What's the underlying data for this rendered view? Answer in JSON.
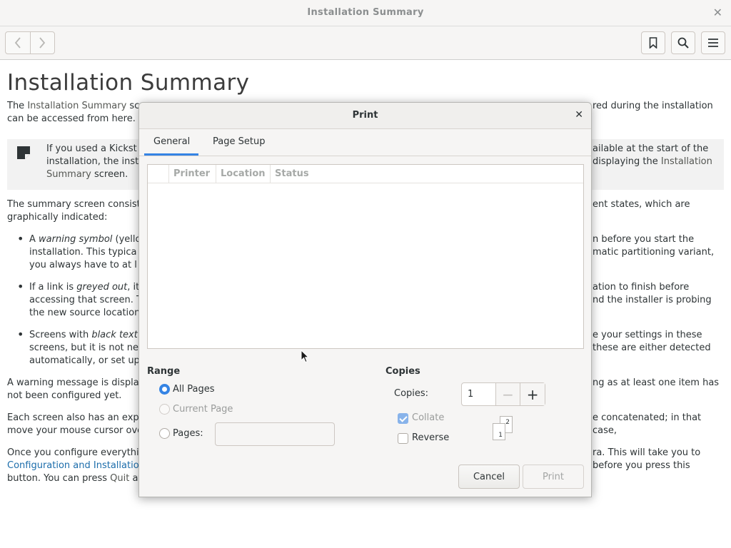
{
  "window": {
    "title": "Installation Summary"
  },
  "toolbar": {
    "back_icon": "chevron-left-icon",
    "forward_icon": "chevron-right-icon",
    "bookmark_icon": "bookmark-icon",
    "search_icon": "search-icon",
    "menu_icon": "hamburger-menu-icon"
  },
  "document": {
    "heading": "Installation Summary",
    "intro": {
      "left_1a": "The ",
      "left_1b": "Installation Summary",
      "left_1c": " sc",
      "left_2": "can be accessed from here.",
      "right_1": "red during the installation"
    },
    "note": {
      "left_1": "If you used a Kickst",
      "left_2": "installation, the inst",
      "left_3a": "Summary",
      "left_3b": " screen.",
      "right_1": "ailable at the start of the",
      "right_2a": " displaying the ",
      "right_2b": "Installation"
    },
    "para2": {
      "left_1": "The summary screen consist",
      "left_2": "graphically indicated:",
      "right_1": "ent states, which are"
    },
    "bullet1": {
      "left_1a": "A ",
      "left_1b": "warning symbol",
      "left_1c": " (yello",
      "left_2": "installation. This typica",
      "left_3": "you always have to at l",
      "right_1": "n before you start the",
      "right_2": "matic partitioning variant,"
    },
    "bullet2": {
      "left_1a": "If a link is ",
      "left_1b": "greyed out",
      "left_1c": ", it",
      "left_2": "accessing that screen. T",
      "left_3": "the new source location",
      "right_1": "ation to finish before",
      "right_2": "nd the installer is probing"
    },
    "bullet3": {
      "left_1a": "Screens with ",
      "left_1b": "black text",
      "left_2": "screens, but it is not ne",
      "left_3": "automatically, or set up",
      "right_1": "e your settings in these",
      "right_2": "these are either detected"
    },
    "para3": {
      "left_1": "A warning message is displa",
      "left_2": "not been configured yet.",
      "right_1": "ng as at least one item has"
    },
    "para4": {
      "left_1": "Each screen also has an exp",
      "left_2": "move your mouse cursor ove",
      "right_1": "e concatenated; in that case,"
    },
    "para5": {
      "left_1": "Once you configure everythi",
      "left_2": "Configuration and Installatio",
      "left_3a": "button. You can press ",
      "left_3b": "Quit",
      "left_3c": " at",
      "right_1": "ra. This will take you to",
      "right_2": " before you press this"
    }
  },
  "print_dialog": {
    "title": "Print",
    "tabs": [
      "General",
      "Page Setup"
    ],
    "active_tab": "General",
    "printer_columns": [
      "Printer",
      "Location",
      "Status"
    ],
    "range": {
      "heading": "Range",
      "all_pages": "All Pages",
      "current_page": "Current Page",
      "pages": "Pages:",
      "selected": "All Pages",
      "pages_value": ""
    },
    "copies": {
      "heading": "Copies",
      "label": "Copies:",
      "value": "1",
      "collate": "Collate",
      "collate_checked": true,
      "reverse": "Reverse",
      "reverse_checked": false,
      "collate_sheet_back": "2",
      "collate_sheet_front": "1"
    },
    "buttons": {
      "cancel": "Cancel",
      "print": "Print"
    }
  },
  "colors": {
    "accent": "#3584e4",
    "link": "#1c6dab"
  }
}
